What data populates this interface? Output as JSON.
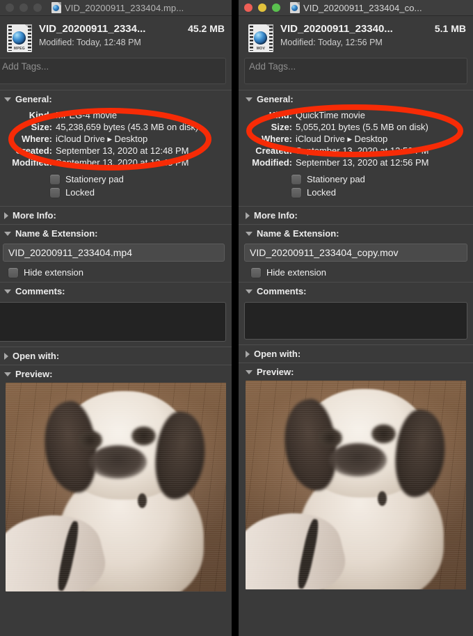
{
  "windows": [
    {
      "id": "left",
      "active": false,
      "titlebar": {
        "title": "VID_20200911_233404.mp...",
        "icon": "mpeg-document-icon",
        "lights": [
          "close-button",
          "minimize-button",
          "maximize-button"
        ]
      },
      "header": {
        "icon": "mpeg-movie-file-icon",
        "icon_format_label": "MPEG",
        "name": "VID_20200911_2334...",
        "size": "45.2 MB",
        "modified": "Modified: Today, 12:48 PM"
      },
      "tags": {
        "placeholder": "Add Tags..."
      },
      "sections": [
        {
          "name": "general",
          "label": "General:",
          "expanded": true,
          "rows": [
            {
              "label": "Kind:",
              "value": "MPEG-4 movie"
            },
            {
              "label": "Size:",
              "value": "45,238,659 bytes (45.3 MB on disk)"
            },
            {
              "label": "Where:",
              "value": "iCloud Drive ▸ Desktop"
            },
            {
              "label": "Created:",
              "value": "September 13, 2020 at 12:48 PM"
            },
            {
              "label": "Modified:",
              "value": "September 13, 2020 at 12:48 PM"
            }
          ],
          "checkboxes": [
            {
              "label": "Stationery pad",
              "checked": false
            },
            {
              "label": "Locked",
              "checked": false
            }
          ]
        },
        {
          "name": "more-info",
          "label": "More Info:",
          "expanded": false
        },
        {
          "name": "name-extension",
          "label": "Name & Extension:",
          "expanded": true,
          "filename": "VID_20200911_233404.mp4",
          "hide_extension_label": "Hide extension",
          "hide_extension_checked": false
        },
        {
          "name": "comments",
          "label": "Comments:",
          "expanded": true,
          "value": ""
        },
        {
          "name": "open-with",
          "label": "Open with:",
          "expanded": false
        },
        {
          "name": "preview",
          "label": "Preview:",
          "expanded": true,
          "image_alt": "fluffy shih tzu puppy sitting on a wooden floor"
        }
      ]
    },
    {
      "id": "right",
      "active": true,
      "titlebar": {
        "title": "VID_20200911_233404_co...",
        "icon": "mov-document-icon",
        "lights": [
          "close-button",
          "minimize-button",
          "maximize-button"
        ]
      },
      "header": {
        "icon": "quicktime-movie-file-icon",
        "icon_format_label": "MOV",
        "name": "VID_20200911_23340...",
        "size": "5.1 MB",
        "modified": "Modified: Today, 12:56 PM"
      },
      "tags": {
        "placeholder": "Add Tags..."
      },
      "sections": [
        {
          "name": "general",
          "label": "General:",
          "expanded": true,
          "rows": [
            {
              "label": "Kind:",
              "value": "QuickTime movie"
            },
            {
              "label": "Size:",
              "value": "5,055,201 bytes (5.5 MB on disk)"
            },
            {
              "label": "Where:",
              "value": "iCloud Drive ▸ Desktop"
            },
            {
              "label": "Created:",
              "value": "September 13, 2020 at 12:56 PM"
            },
            {
              "label": "Modified:",
              "value": "September 13, 2020 at 12:56 PM"
            }
          ],
          "checkboxes": [
            {
              "label": "Stationery pad",
              "checked": false
            },
            {
              "label": "Locked",
              "checked": false
            }
          ]
        },
        {
          "name": "more-info",
          "label": "More Info:",
          "expanded": false
        },
        {
          "name": "name-extension",
          "label": "Name & Extension:",
          "expanded": true,
          "filename": "VID_20200911_233404_copy.mov",
          "hide_extension_label": "Hide extension",
          "hide_extension_checked": false
        },
        {
          "name": "comments",
          "label": "Comments:",
          "expanded": true,
          "value": ""
        },
        {
          "name": "open-with",
          "label": "Open with:",
          "expanded": false
        },
        {
          "name": "preview",
          "label": "Preview:",
          "expanded": true,
          "image_alt": "fluffy shih tzu puppy sitting on a wooden floor"
        }
      ]
    }
  ],
  "annotations": {
    "color": "#f72b06",
    "stroke_width": 7,
    "shapes": [
      {
        "name": "highlight-ellipse-left",
        "target": "left kind / size / where rows"
      },
      {
        "name": "highlight-ellipse-right",
        "target": "right kind / size / where rows"
      }
    ]
  }
}
